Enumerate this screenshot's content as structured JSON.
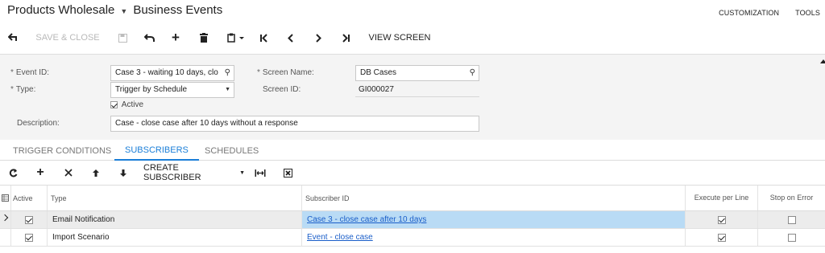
{
  "header": {
    "company": "Products Wholesale",
    "screen_title": "Business Events",
    "menu": [
      "CUSTOMIZATION",
      "TOOLS"
    ]
  },
  "toolbar": {
    "save_close_label": "SAVE & CLOSE",
    "view_screen_label": "VIEW SCREEN",
    "icons": [
      "back-icon",
      "save-icon",
      "undo-icon",
      "add-icon",
      "delete-icon",
      "copy-paste-icon",
      "first-record-icon",
      "previous-record-icon",
      "next-record-icon",
      "last-record-icon"
    ]
  },
  "form": {
    "event_id_label": "Event ID:",
    "event_id_value": "Case 3 - waiting 10 days, clo",
    "type_label": "Type:",
    "type_value": "Trigger by Schedule",
    "active_label": "Active",
    "active_checked": true,
    "screen_name_label": "Screen Name:",
    "screen_name_value": "DB Cases",
    "screen_id_label": "Screen ID:",
    "screen_id_value": "GI000027",
    "description_label": "Description:",
    "description_value": "Case - close case after 10 days without a response",
    "required_marker": "*"
  },
  "tabs": [
    {
      "label": "TRIGGER CONDITIONS",
      "active": false
    },
    {
      "label": "SUBSCRIBERS",
      "active": true
    },
    {
      "label": "SCHEDULES",
      "active": false
    }
  ],
  "grid_toolbar": {
    "create_subscriber_label": "CREATE SUBSCRIBER",
    "icons": [
      "refresh-icon",
      "add-row-icon",
      "remove-row-icon",
      "move-up-icon",
      "move-down-icon",
      "fit-width-icon",
      "export-excel-icon"
    ]
  },
  "grid": {
    "columns": {
      "active": "Active",
      "type": "Type",
      "subscriber_id": "Subscriber ID",
      "execute_per_line": "Execute per Line",
      "stop_on_error": "Stop on Error"
    },
    "rows": [
      {
        "active": true,
        "type": "Email Notification",
        "subscriber_id": "Case 3 - close case after 10 days",
        "execute_per_line": true,
        "stop_on_error": false
      },
      {
        "active": true,
        "type": "Import Scenario",
        "subscriber_id": "Event - close case",
        "execute_per_line": true,
        "stop_on_error": false
      }
    ]
  },
  "colors": {
    "accent": "#1a7ed8",
    "link": "#1a5ec9",
    "selection": "#b9dbf5",
    "form_background": "#f4f4f4"
  }
}
